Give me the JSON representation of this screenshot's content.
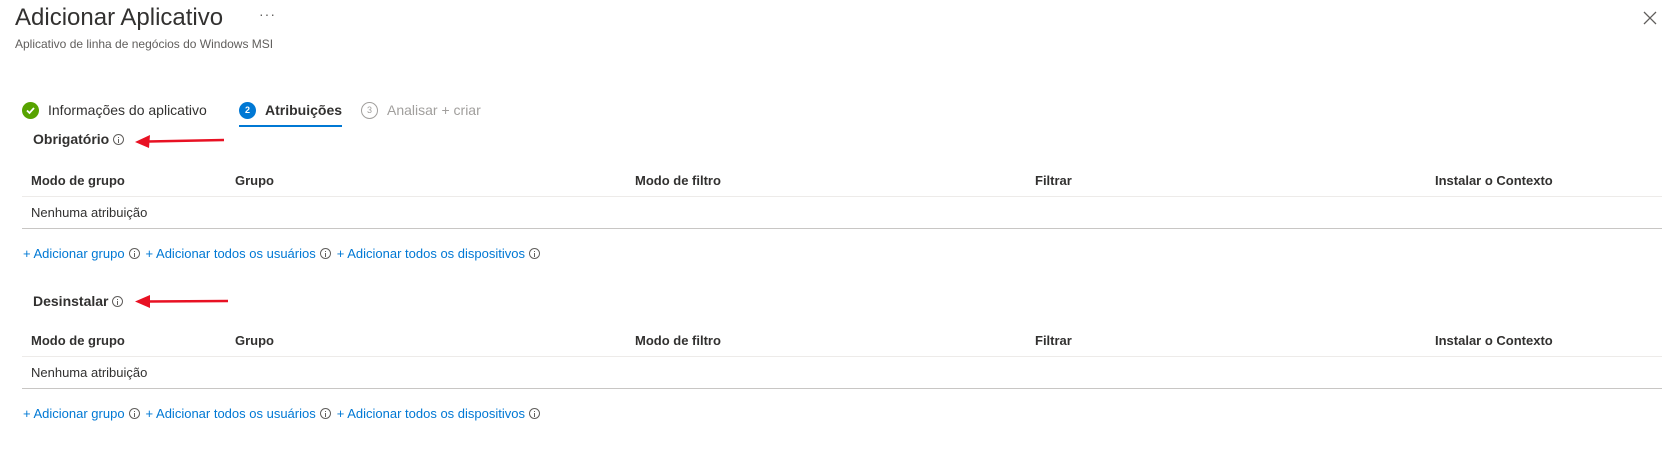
{
  "header": {
    "title": "Adicionar Aplicativo",
    "more": "···",
    "subtitle": "Aplicativo de linha de negócios do Windows MSI"
  },
  "steps": [
    {
      "label": "Informações do aplicativo",
      "number": "",
      "state": "completed"
    },
    {
      "label": "Atribuições",
      "number": "2",
      "state": "active"
    },
    {
      "label": "Analisar + criar",
      "number": "3",
      "state": "disabled"
    }
  ],
  "columns": [
    "Modo de grupo",
    "Grupo",
    "Modo de filtro",
    "Filtrar",
    "Instalar o Contexto"
  ],
  "sections": [
    {
      "title": "Obrigatório",
      "empty_text": "Nenhuma atribuição",
      "links": [
        "+ Adicionar grupo",
        "+ Adicionar todos os usuários",
        "+ Adicionar todos os dispositivos"
      ]
    },
    {
      "title": "Desinstalar",
      "empty_text": "Nenhuma atribuição",
      "links": [
        "+ Adicionar grupo",
        "+ Adicionar todos os usuários",
        "+ Adicionar todos os dispositivos"
      ]
    }
  ],
  "colors": {
    "accent": "#0078d4",
    "success": "#57a300",
    "annotation_arrow": "#e81123"
  }
}
